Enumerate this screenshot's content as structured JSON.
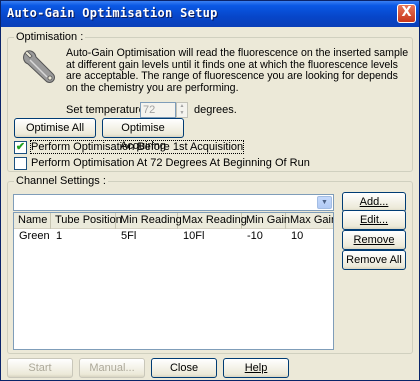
{
  "window": {
    "title": "Auto-Gain Optimisation Setup",
    "close_glyph": "X"
  },
  "optimisation": {
    "legend": "Optimisation :",
    "description": "Auto-Gain Optimisation will read the fluorescence on the inserted sample at different gain levels until it finds one at which the fluorescence levels are acceptable. The range of fluorescence you are looking for depends on the chemistry you are performing.",
    "temp_label": "Set temperature to",
    "temp_value": "72",
    "temp_unit": "degrees.",
    "optimise_all_label": "Optimise All",
    "optimise_acquiring_label": "Optimise Acquiring",
    "check_before_label": "Perform Optimisation Before 1st Acquisition",
    "check_before_checked": true,
    "check_before_mark": "✔",
    "check_at72_label": "Perform Optimisation At 72 Degrees At Beginning Of Run",
    "check_at72_checked": false
  },
  "channel_settings": {
    "legend": "Channel Settings :",
    "combo_value": "",
    "add_label": "Add...",
    "edit_label": "Edit...",
    "remove_label": "Remove",
    "remove_all_label": "Remove All",
    "columns": [
      "Name",
      "Tube Position",
      "Min Reading",
      "Max Reading",
      "Min Gain",
      "Max Gain"
    ],
    "rows": [
      {
        "name": "Green",
        "tube_position": "1",
        "min_reading": "5Fl",
        "max_reading": "10Fl",
        "min_gain": "-10",
        "max_gain": "10"
      }
    ]
  },
  "footer": {
    "start_label": "Start",
    "manual_label": "Manual...",
    "close_label": "Close",
    "help_label": "Help"
  },
  "icons": {
    "wrench": "wrench-icon",
    "spinner": "spinner-arrows-icon",
    "dropdown": "chevron-down-icon"
  },
  "colors": {
    "titlebar": "#0746c9",
    "dialog_bg": "#ece9d8",
    "checkmark": "#21a121"
  }
}
